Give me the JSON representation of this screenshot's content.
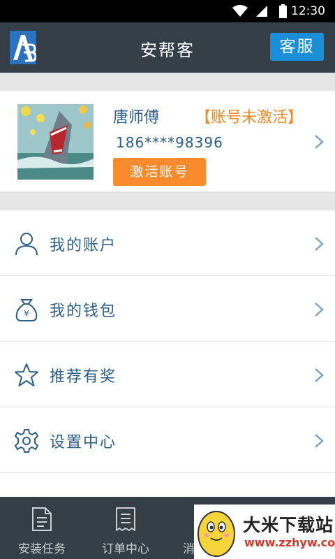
{
  "status_bar": {
    "time": "12:30"
  },
  "header": {
    "title": "安帮客",
    "service_button": "客服",
    "logo_text": "安帮客"
  },
  "profile": {
    "name": "唐师傅",
    "account_status": "【账号未激活】",
    "phone": "186****98396",
    "activate_button": "激活账号"
  },
  "menu": {
    "items": [
      {
        "label": "我的账户",
        "icon": "user-icon"
      },
      {
        "label": "我的钱包",
        "icon": "wallet-icon"
      },
      {
        "label": "推荐有奖",
        "icon": "star-icon"
      },
      {
        "label": "设置中心",
        "icon": "gear-icon"
      }
    ]
  },
  "tabs": [
    {
      "label": "安装任务",
      "icon": "document-icon"
    },
    {
      "label": "订单中心",
      "icon": "receipt-icon"
    },
    {
      "label": "消",
      "icon": "message-icon"
    }
  ],
  "watermark": {
    "title": "大米下载站",
    "url": "www.zzhyw.com"
  },
  "colors": {
    "header_bg": "#333e46",
    "accent_blue": "#1a8fd8",
    "orange": "#f98b2f",
    "text_blue": "#2b5e89"
  }
}
